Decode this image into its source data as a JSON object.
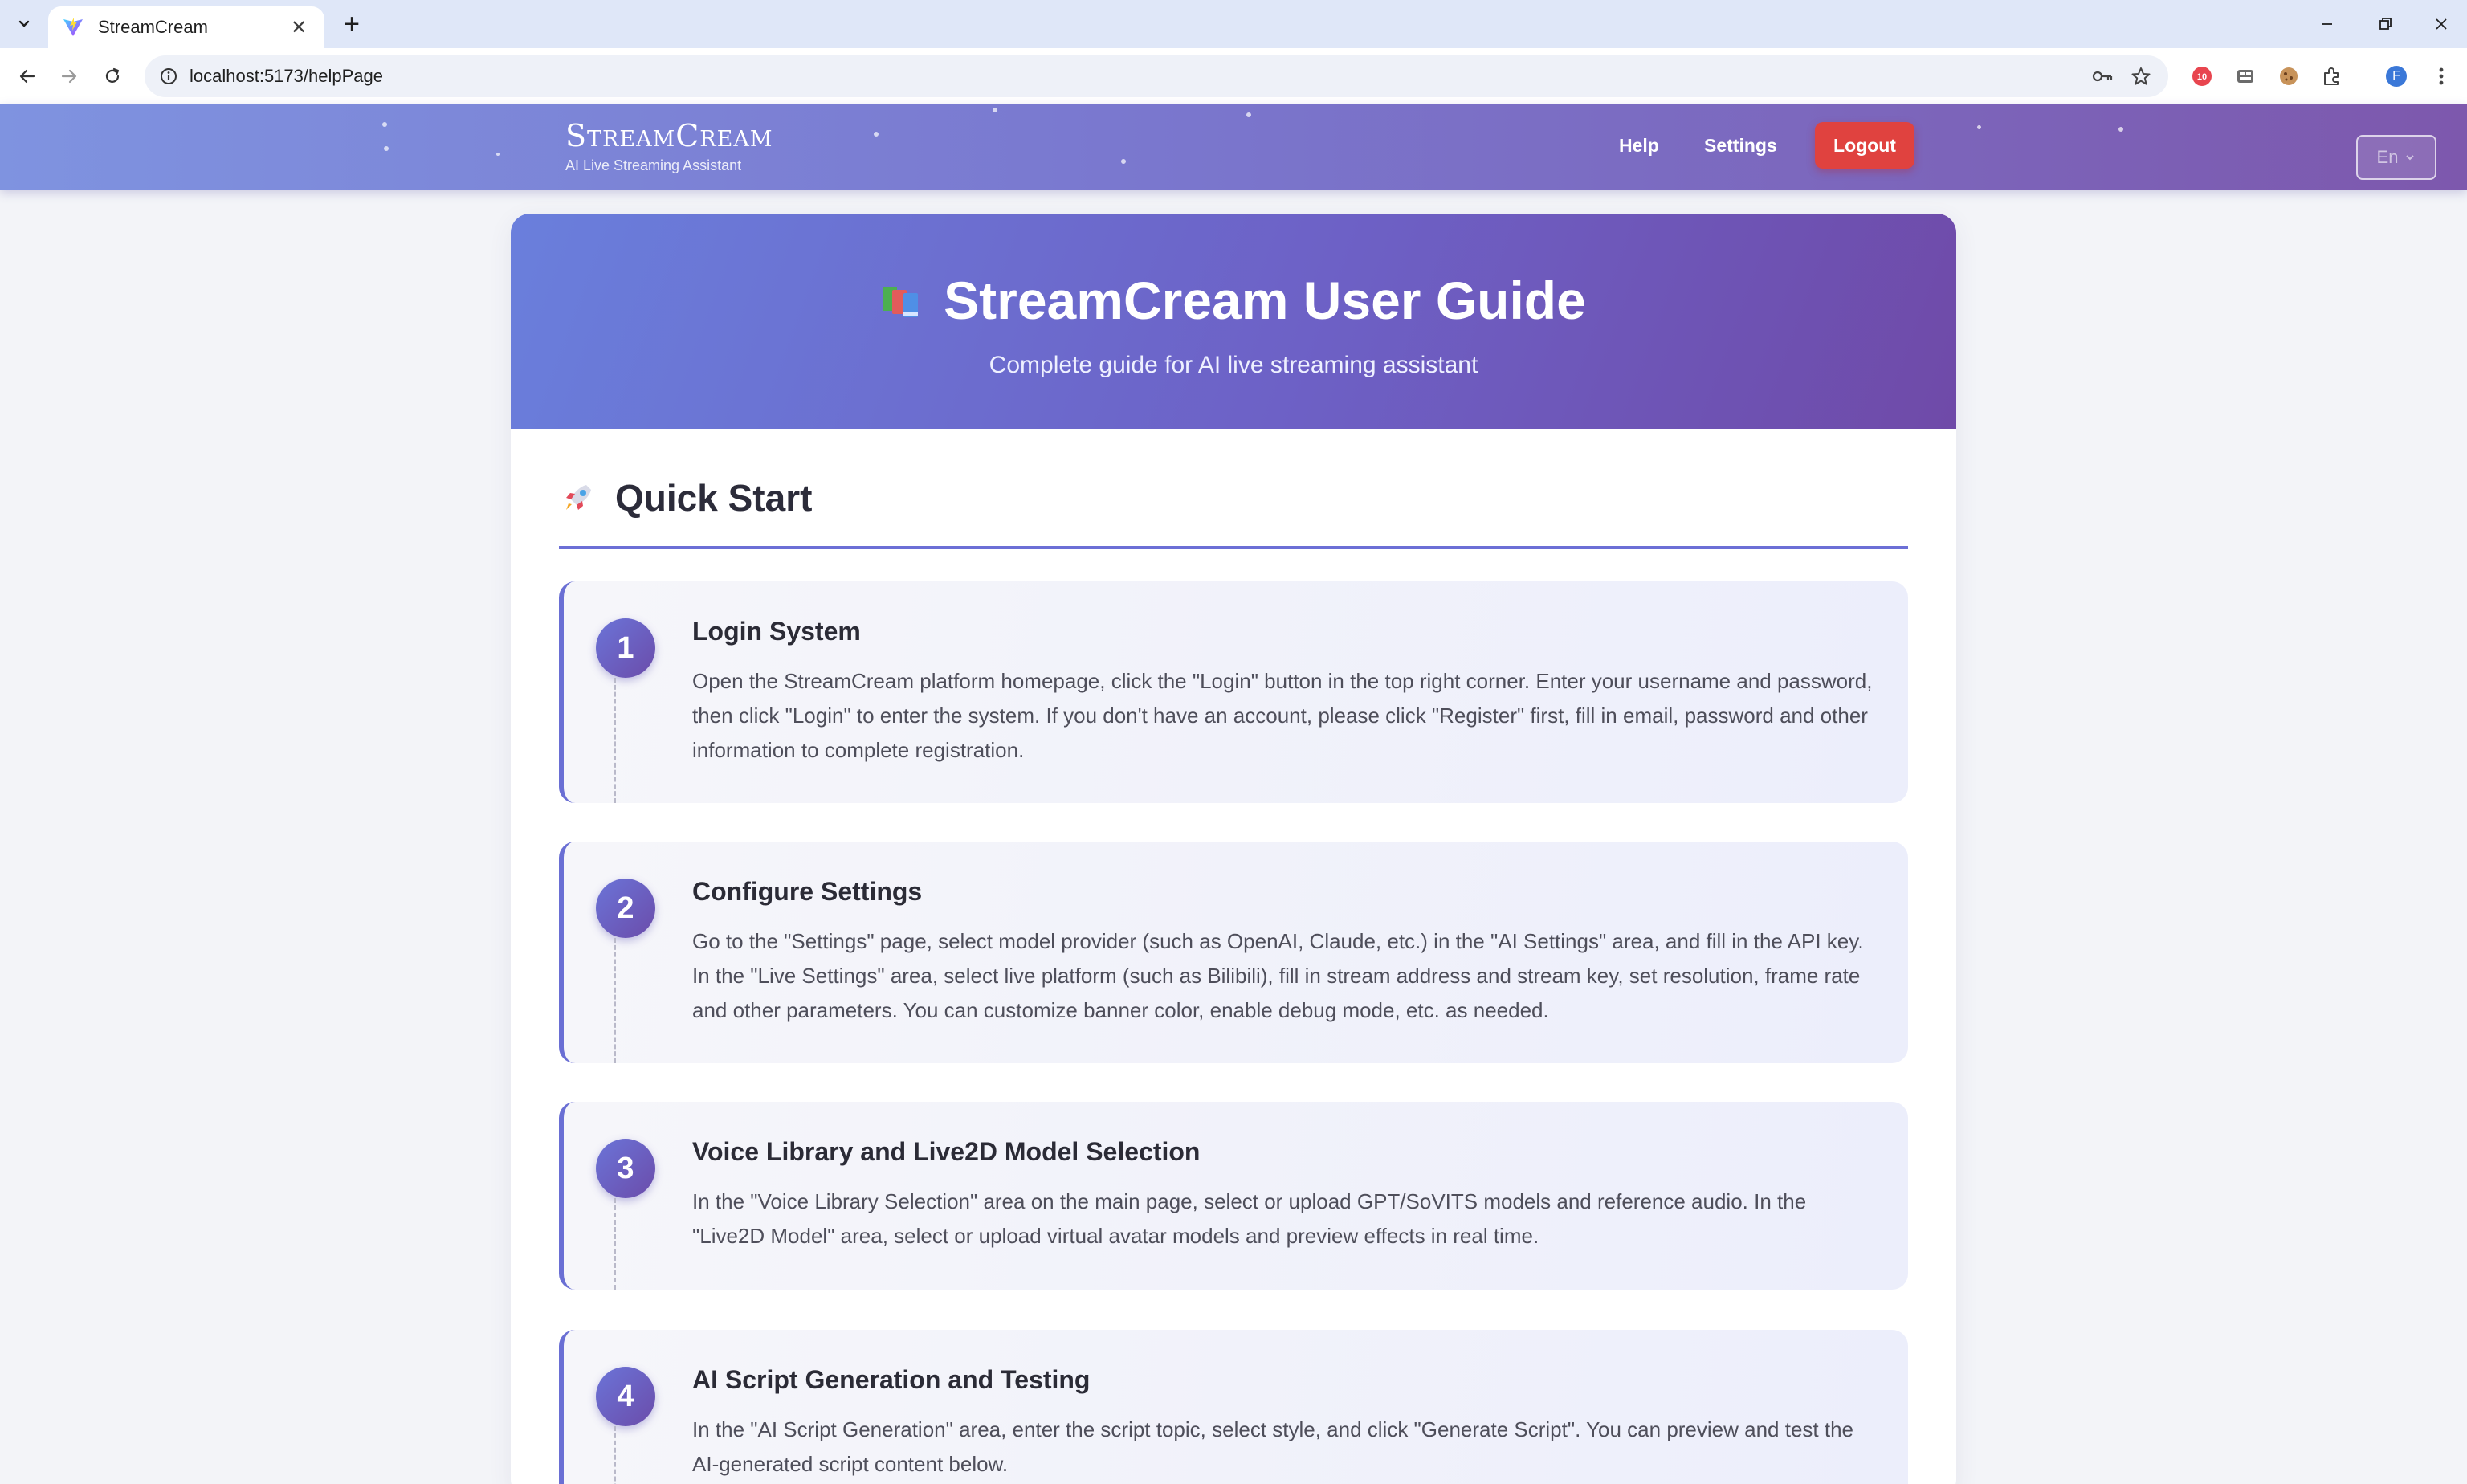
{
  "browser": {
    "tab_title": "StreamCream",
    "new_tab_symbol": "+",
    "url": "localhost:5173/helpPage",
    "profile_initial": "F"
  },
  "navbar": {
    "brand_name": "StreamCream",
    "brand_tagline": "AI Live Streaming Assistant",
    "help_label": "Help",
    "settings_label": "Settings",
    "logout_label": "Logout",
    "language": "En"
  },
  "hero": {
    "title": "StreamCream User Guide",
    "subtitle": "Complete guide for AI live streaming assistant"
  },
  "quick_start": {
    "title": "Quick Start",
    "steps": [
      {
        "number": "1",
        "title": "Login System",
        "text": "Open the StreamCream platform homepage, click the \"Login\" button in the top right corner. Enter your username and password, then click \"Login\" to enter the system. If you don't have an account, please click \"Register\" first, fill in email, password and other information to complete registration."
      },
      {
        "number": "2",
        "title": "Configure Settings",
        "text": "Go to the \"Settings\" page, select model provider (such as OpenAI, Claude, etc.) in the \"AI Settings\" area, and fill in the API key. In the \"Live Settings\" area, select live platform (such as Bilibili), fill in stream address and stream key, set resolution, frame rate and other parameters. You can customize banner color, enable debug mode, etc. as needed."
      },
      {
        "number": "3",
        "title": "Voice Library and Live2D Model Selection",
        "text": "In the \"Voice Library Selection\" area on the main page, select or upload GPT/SoVITS models and reference audio. In the \"Live2D Model\" area, select or upload virtual avatar models and preview effects in real time."
      },
      {
        "number": "4",
        "title": "AI Script Generation and Testing",
        "text": "In the \"AI Script Generation\" area, enter the script topic, select style, and click \"Generate Script\". You can preview and test the AI-generated script content below."
      }
    ]
  },
  "colors": {
    "accent": "#6c6fd6",
    "logout": "#e0423f",
    "nav_gradient_start": "#7f93e0",
    "nav_gradient_end": "#7d58ad"
  }
}
